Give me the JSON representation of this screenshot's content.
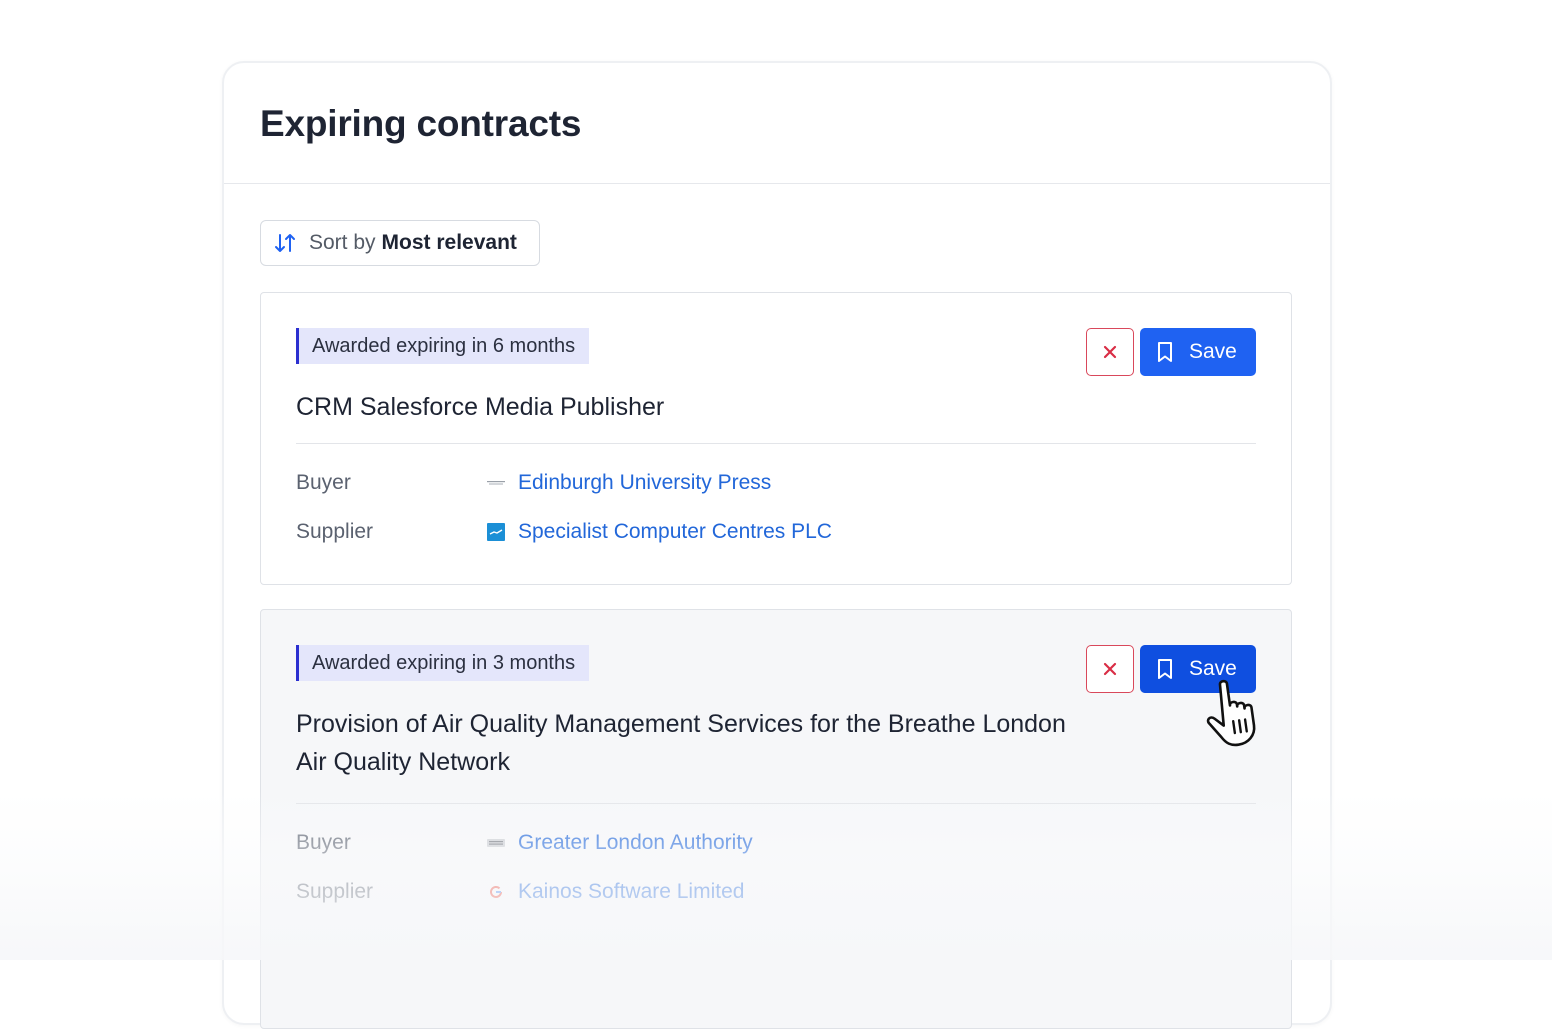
{
  "header": {
    "title": "Expiring contracts"
  },
  "sort": {
    "prefix": "Sort by",
    "value": "Most relevant",
    "icon": "sort-arrows-icon"
  },
  "contracts": [
    {
      "status": "Awarded expiring in 6 months",
      "title": "CRM Salesforce Media Publisher",
      "buyer_label": "Buyer",
      "buyer": "Edinburgh University Press",
      "supplier_label": "Supplier",
      "supplier": "Specialist Computer Centres PLC",
      "save_label": "Save"
    },
    {
      "status": "Awarded expiring in 3 months",
      "title": "Provision of Air Quality Management Services for the Breathe London Air Quality Network",
      "buyer_label": "Buyer",
      "buyer": "Greater London Authority",
      "supplier_label": "Supplier",
      "supplier": "Kainos Software Limited",
      "save_label": "Save"
    }
  ],
  "icons": {
    "dismiss": "close-icon",
    "save": "bookmark-icon",
    "cursor": "hand-pointer-icon"
  },
  "colors": {
    "accent": "#1f62f2",
    "link": "#2267d9",
    "badge_bg": "#e4e6fb",
    "badge_border": "#2b2fd0",
    "danger": "#d9485b"
  }
}
